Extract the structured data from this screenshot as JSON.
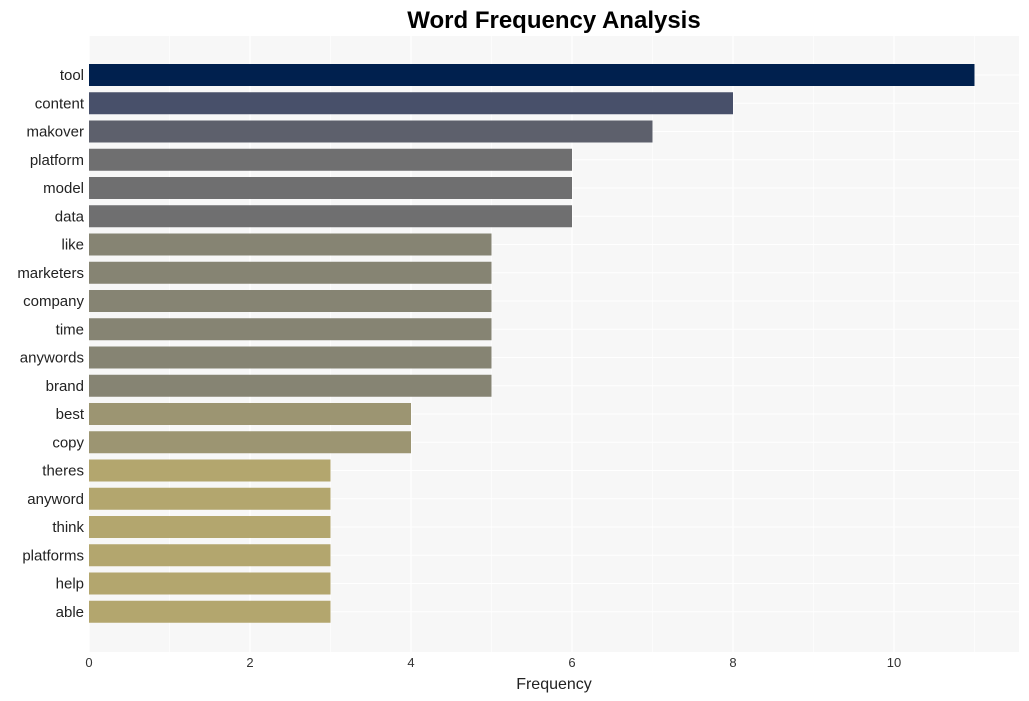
{
  "chart_data": {
    "type": "bar",
    "orientation": "horizontal",
    "title": "Word Frequency Analysis",
    "xlabel": "Frequency",
    "ylabel": "",
    "xlim": [
      0,
      11.55
    ],
    "xticks": [
      0,
      2,
      4,
      6,
      8,
      10
    ],
    "xtick_labels": [
      "0",
      "2",
      "4",
      "6",
      "8",
      "10"
    ],
    "grid": true,
    "legend": "none",
    "categories": [
      "tool",
      "content",
      "makover",
      "platform",
      "model",
      "data",
      "like",
      "marketers",
      "company",
      "time",
      "anywords",
      "brand",
      "best",
      "copy",
      "theres",
      "anyword",
      "think",
      "platforms",
      "help",
      "able"
    ],
    "values": [
      11,
      8,
      7,
      6,
      6,
      6,
      5,
      5,
      5,
      5,
      5,
      5,
      4,
      4,
      3,
      3,
      3,
      3,
      3,
      3
    ],
    "colors": [
      "#00204e",
      "#48506a",
      "#5d606c",
      "#6f6f70",
      "#6f6f70",
      "#6f6f70",
      "#868473",
      "#868473",
      "#868473",
      "#868473",
      "#868473",
      "#868473",
      "#9c9572",
      "#9c9572",
      "#b3a66e",
      "#b3a66e",
      "#b3a66e",
      "#b3a66e",
      "#b3a66e",
      "#b3a66e"
    ],
    "plot_background": "#f7f7f7",
    "grid_color": "#ffffff"
  }
}
